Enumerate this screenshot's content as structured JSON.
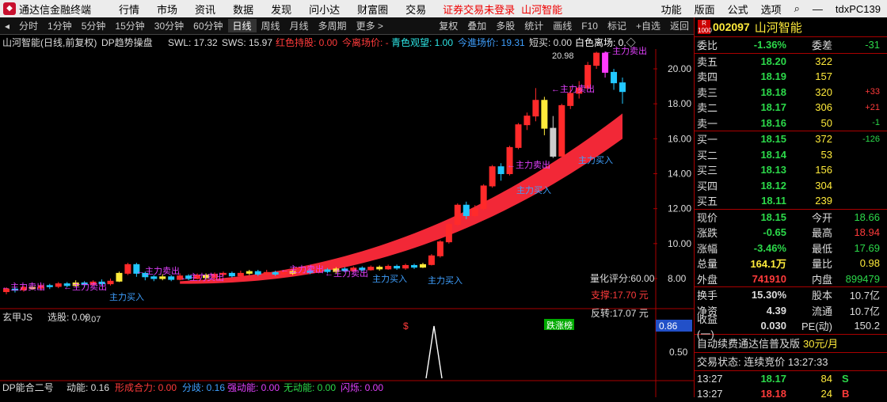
{
  "titlebar": {
    "app": "通达信金融终端",
    "menus": [
      "行情",
      "市场",
      "资讯",
      "数据",
      "发现",
      "问小达",
      "财富圈",
      "交易"
    ],
    "warning": "证券交易未登录",
    "stock": "山河智能",
    "right_menus": [
      "功能",
      "版面",
      "公式",
      "选项"
    ],
    "user": "tdxPC139"
  },
  "toolbar": {
    "periods": [
      "分时",
      "1分钟",
      "5分钟",
      "15分钟",
      "30分钟",
      "60分钟",
      "日线",
      "周线",
      "月线",
      "多周期",
      "更多 >"
    ],
    "active": "日线",
    "right": [
      "复权",
      "叠加",
      "多股",
      "统计",
      "画线",
      "F10",
      "标记",
      "+自选",
      "返回"
    ]
  },
  "chart": {
    "title": "山河智能(日线,前复权)",
    "indicator": "DP趋势操盘",
    "swl": "SWL: 17.32",
    "sws": "SWS: 15.97",
    "red_hold": "红色持股: 0.00",
    "today_exit": "今离场价: -",
    "cyan_watch": "青色观望: 1.00",
    "today_entry": "今進场价: 19.31",
    "short": "短买: 0.00",
    "white_exit": "白色离场: 0.◇",
    "y_ticks": [
      "20.00",
      "18.00",
      "16.00",
      "14.00",
      "12.00",
      "10.00",
      "8.00"
    ],
    "high_mark": "20.98",
    "low_mark": "7.07",
    "score": "量化评分:60.00",
    "support": "支撑:17.70 元",
    "reverse": "反转:17.07 元",
    "limit_tag": "跌涨榜",
    "signal_s": "$",
    "sell_label": "←主力卖出",
    "buy_label": "主力买入",
    "candles": [
      {
        "o": 7.25,
        "c": 7.4,
        "h": 7.5,
        "l": 7.1
      },
      {
        "o": 7.4,
        "c": 7.35,
        "h": 7.5,
        "l": 7.2
      },
      {
        "o": 7.35,
        "c": 7.5,
        "h": 7.6,
        "l": 7.25
      },
      {
        "o": 7.5,
        "c": 7.45,
        "h": 7.6,
        "l": 7.35
      },
      {
        "o": 7.45,
        "c": 7.6,
        "h": 7.7,
        "l": 7.3
      },
      {
        "o": 7.6,
        "c": 7.55,
        "h": 7.7,
        "l": 7.4
      },
      {
        "o": 7.55,
        "c": 7.7,
        "h": 7.8,
        "l": 7.45
      },
      {
        "o": 7.7,
        "c": 7.6,
        "h": 7.8,
        "l": 7.5
      },
      {
        "o": 7.6,
        "c": 7.75,
        "h": 7.9,
        "l": 7.55
      },
      {
        "o": 7.75,
        "c": 7.65,
        "h": 7.85,
        "l": 7.5
      },
      {
        "o": 7.65,
        "c": 7.8,
        "h": 7.9,
        "l": 7.55
      },
      {
        "o": 7.8,
        "c": 7.7,
        "h": 7.95,
        "l": 7.6
      },
      {
        "o": 7.7,
        "c": 7.85,
        "h": 8.0,
        "l": 7.6
      },
      {
        "o": 7.85,
        "c": 8.3,
        "h": 8.4,
        "l": 7.8
      },
      {
        "o": 8.3,
        "c": 8.8,
        "h": 8.9,
        "l": 8.2
      },
      {
        "o": 8.8,
        "c": 8.3,
        "h": 8.9,
        "l": 8.1
      },
      {
        "o": 8.3,
        "c": 8.1,
        "h": 8.4,
        "l": 7.9
      },
      {
        "o": 8.1,
        "c": 8.0,
        "h": 8.2,
        "l": 7.85
      },
      {
        "o": 8.0,
        "c": 8.1,
        "h": 8.25,
        "l": 7.9
      },
      {
        "o": 8.1,
        "c": 7.95,
        "h": 8.2,
        "l": 7.85
      },
      {
        "o": 7.95,
        "c": 8.15,
        "h": 8.3,
        "l": 7.9
      },
      {
        "o": 8.15,
        "c": 8.0,
        "h": 8.25,
        "l": 7.9
      },
      {
        "o": 8.0,
        "c": 8.2,
        "h": 8.3,
        "l": 7.95
      },
      {
        "o": 8.2,
        "c": 8.05,
        "h": 8.3,
        "l": 7.95
      },
      {
        "o": 8.05,
        "c": 8.25,
        "h": 8.35,
        "l": 8.0
      },
      {
        "o": 8.25,
        "c": 8.3,
        "h": 8.4,
        "l": 8.1
      },
      {
        "o": 8.3,
        "c": 8.15,
        "h": 8.4,
        "l": 8.05
      },
      {
        "o": 8.15,
        "c": 8.3,
        "h": 8.45,
        "l": 8.1
      },
      {
        "o": 8.3,
        "c": 8.4,
        "h": 8.5,
        "l": 8.2
      },
      {
        "o": 8.4,
        "c": 8.25,
        "h": 8.5,
        "l": 8.15
      },
      {
        "o": 8.25,
        "c": 8.35,
        "h": 8.5,
        "l": 8.15
      },
      {
        "o": 8.35,
        "c": 8.25,
        "h": 8.45,
        "l": 8.15
      },
      {
        "o": 8.25,
        "c": 8.4,
        "h": 8.5,
        "l": 8.2
      },
      {
        "o": 8.4,
        "c": 8.3,
        "h": 8.5,
        "l": 8.2
      },
      {
        "o": 8.3,
        "c": 8.45,
        "h": 8.55,
        "l": 8.2
      },
      {
        "o": 8.45,
        "c": 8.35,
        "h": 8.55,
        "l": 8.25
      },
      {
        "o": 8.35,
        "c": 8.5,
        "h": 8.6,
        "l": 8.3
      },
      {
        "o": 8.5,
        "c": 8.4,
        "h": 8.6,
        "l": 8.3
      },
      {
        "o": 8.4,
        "c": 8.55,
        "h": 8.65,
        "l": 8.3
      },
      {
        "o": 8.55,
        "c": 8.45,
        "h": 8.65,
        "l": 8.35
      },
      {
        "o": 8.45,
        "c": 8.6,
        "h": 8.7,
        "l": 8.35
      },
      {
        "o": 8.6,
        "c": 8.5,
        "h": 8.7,
        "l": 8.4
      },
      {
        "o": 8.5,
        "c": 8.65,
        "h": 8.75,
        "l": 8.45
      },
      {
        "o": 8.65,
        "c": 8.55,
        "h": 8.75,
        "l": 8.45
      },
      {
        "o": 8.55,
        "c": 8.7,
        "h": 8.8,
        "l": 8.5
      },
      {
        "o": 8.7,
        "c": 8.6,
        "h": 8.8,
        "l": 8.5
      },
      {
        "o": 8.6,
        "c": 8.75,
        "h": 8.85,
        "l": 8.5
      },
      {
        "o": 8.75,
        "c": 8.65,
        "h": 8.85,
        "l": 8.55
      },
      {
        "o": 8.65,
        "c": 8.8,
        "h": 8.9,
        "l": 8.6
      },
      {
        "o": 8.8,
        "c": 9.3,
        "h": 9.4,
        "l": 8.75
      },
      {
        "o": 9.3,
        "c": 10.1,
        "h": 10.2,
        "l": 9.2
      },
      {
        "o": 10.1,
        "c": 11.1,
        "h": 11.2,
        "l": 10.0
      },
      {
        "o": 11.1,
        "c": 12.2,
        "h": 12.3,
        "l": 11.0
      },
      {
        "o": 12.2,
        "c": 11.6,
        "h": 12.4,
        "l": 11.4
      },
      {
        "o": 11.6,
        "c": 12.0,
        "h": 12.2,
        "l": 11.5
      },
      {
        "o": 12.0,
        "c": 13.3,
        "h": 13.4,
        "l": 11.9
      },
      {
        "o": 13.3,
        "c": 14.4,
        "h": 14.5,
        "l": 13.2
      },
      {
        "o": 14.4,
        "c": 14.0,
        "h": 14.6,
        "l": 13.6
      },
      {
        "o": 14.0,
        "c": 15.5,
        "h": 15.6,
        "l": 13.9
      },
      {
        "o": 15.5,
        "c": 16.8,
        "h": 16.9,
        "l": 15.4
      },
      {
        "o": 16.8,
        "c": 17.3,
        "h": 17.5,
        "l": 16.5
      },
      {
        "o": 17.3,
        "c": 18.2,
        "h": 18.9,
        "l": 17.0
      },
      {
        "o": 18.2,
        "c": 16.6,
        "h": 18.4,
        "l": 16.2
      },
      {
        "o": 16.6,
        "c": 15.0,
        "h": 17.3,
        "l": 14.9
      },
      {
        "o": 15.0,
        "c": 17.9,
        "h": 18.0,
        "l": 15.0
      },
      {
        "o": 17.9,
        "c": 18.6,
        "h": 19.0,
        "l": 17.7
      },
      {
        "o": 18.6,
        "c": 18.9,
        "h": 19.3,
        "l": 18.3
      },
      {
        "o": 18.9,
        "c": 20.2,
        "h": 20.4,
        "l": 18.8
      },
      {
        "o": 20.2,
        "c": 20.9,
        "h": 20.98,
        "l": 20.0
      },
      {
        "o": 20.9,
        "c": 19.8,
        "h": 21.0,
        "l": 19.5
      },
      {
        "o": 19.8,
        "c": 19.2,
        "h": 20.0,
        "l": 18.8
      },
      {
        "o": 19.2,
        "c": 18.7,
        "h": 19.5,
        "l": 18.0
      }
    ],
    "panel2": {
      "title": "玄甲JS",
      "select": "选股: 0.00",
      "ticks": [
        "0.86",
        "0.50"
      ]
    },
    "panel3": {
      "title": "DP能合二号",
      "items": [
        {
          "label": "动能: 0.16",
          "color": "#ddd"
        },
        {
          "label": "形成合力: 0.00",
          "color": "#ff3b3b"
        },
        {
          "label": "分歧: 0.16",
          "color": "#3fa0ff"
        },
        {
          "label": "强动能: 0.00",
          "color": "#e040fb"
        },
        {
          "label": "无动能: 0.00",
          "color": "#2cd94a"
        },
        {
          "label": "闪烁: 0.00",
          "color": "#e040fb"
        }
      ]
    }
  },
  "quote": {
    "code": "002097",
    "name": "山河智能",
    "r_box": "R 1000",
    "weibi_label": "委比",
    "weibi": "-1.36%",
    "weicha_label": "委差",
    "weicha": "-31",
    "asks": [
      {
        "label": "卖五",
        "price": "18.20",
        "vol": "322",
        "chg": ""
      },
      {
        "label": "卖四",
        "price": "18.19",
        "vol": "157",
        "chg": ""
      },
      {
        "label": "卖三",
        "price": "18.18",
        "vol": "320",
        "chg": "+33"
      },
      {
        "label": "卖二",
        "price": "18.17",
        "vol": "306",
        "chg": "+21"
      },
      {
        "label": "卖一",
        "price": "18.16",
        "vol": "50",
        "chg": "-1"
      }
    ],
    "bids": [
      {
        "label": "买一",
        "price": "18.15",
        "vol": "372",
        "chg": "-126"
      },
      {
        "label": "买二",
        "price": "18.14",
        "vol": "53",
        "chg": ""
      },
      {
        "label": "买三",
        "price": "18.13",
        "vol": "156",
        "chg": ""
      },
      {
        "label": "买四",
        "price": "18.12",
        "vol": "304",
        "chg": ""
      },
      {
        "label": "买五",
        "price": "18.11",
        "vol": "239",
        "chg": ""
      }
    ],
    "stats": [
      {
        "l1": "现价",
        "v1": "18.15",
        "c1": "g",
        "l2": "今开",
        "v2": "18.66",
        "c2": "g"
      },
      {
        "l1": "涨跌",
        "v1": "-0.65",
        "c1": "g",
        "l2": "最高",
        "v2": "18.94",
        "c2": "r"
      },
      {
        "l1": "涨幅",
        "v1": "-3.46%",
        "c1": "g",
        "l2": "最低",
        "v2": "17.69",
        "c2": "g"
      },
      {
        "l1": "总量",
        "v1": "164.1万",
        "c1": "y",
        "l2": "量比",
        "v2": "0.98",
        "c2": "y"
      },
      {
        "l1": "外盘",
        "v1": "741910",
        "c1": "r",
        "l2": "内盘",
        "v2": "899479",
        "c2": "g"
      }
    ],
    "stats2": [
      {
        "l1": "换手",
        "v1": "15.30%",
        "l2": "股本",
        "v2": "10.7亿"
      },
      {
        "l1": "净资",
        "v1": "4.39",
        "l2": "流通",
        "v2": "10.7亿"
      },
      {
        "l1": "收益(一)",
        "v1": "0.030",
        "l2": "PE(动)",
        "v2": "150.2"
      }
    ],
    "banner": "自动续费通达信普及版",
    "banner_price": "30元/月",
    "trade_status": "交易状态: 连续竞价 13:27:33",
    "ticks": [
      {
        "time": "13:27",
        "price": "18.17",
        "vol": "84",
        "side": "S"
      },
      {
        "time": "13:27",
        "price": "18.18",
        "vol": "24",
        "side": "B"
      }
    ]
  }
}
